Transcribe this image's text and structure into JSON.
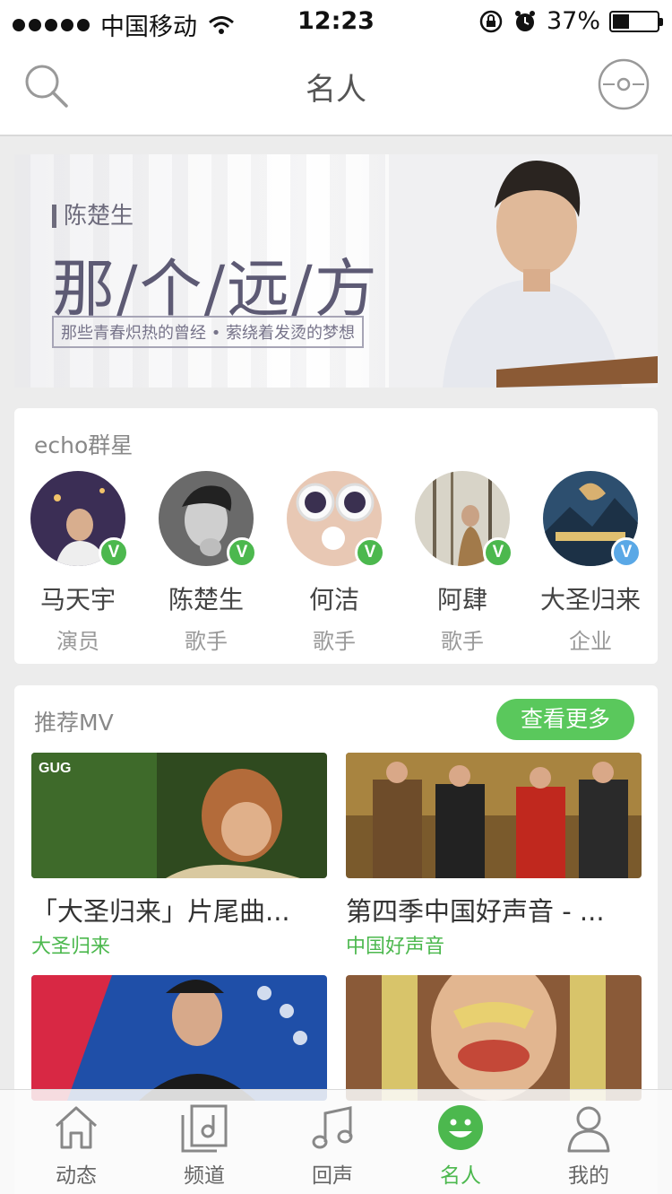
{
  "status_bar": {
    "carrier": "中国移动",
    "time": "12:23",
    "battery": "37%",
    "battery_level": 0.37
  },
  "nav": {
    "title": "名人",
    "search_icon": "search-icon",
    "player_icon": "disc-icon"
  },
  "banner": {
    "artist": "陈楚生",
    "title": "那/个/远/方",
    "subtitle": "那些青春炽热的曾经 • 萦绕着发烫的梦想"
  },
  "stars": {
    "heading": "echo群星",
    "items": [
      {
        "name": "马天宇",
        "role": "演员",
        "badge": "V",
        "badge_color": "#4cb84e"
      },
      {
        "name": "陈楚生",
        "role": "歌手",
        "badge": "V",
        "badge_color": "#4cb84e"
      },
      {
        "name": "何洁",
        "role": "歌手",
        "badge": "V",
        "badge_color": "#4cb84e"
      },
      {
        "name": "阿肆",
        "role": "歌手",
        "badge": "V",
        "badge_color": "#4cb84e"
      },
      {
        "name": "大圣归来",
        "role": "企业",
        "badge": "V",
        "badge_color": "#5aa8e6"
      }
    ]
  },
  "mv": {
    "heading": "推荐MV",
    "more_label": "查看更多",
    "items": [
      {
        "title": "「大圣归来」片尾曲...",
        "tag": "大圣归来"
      },
      {
        "title": "第四季中国好声音 - ...",
        "tag": "中国好声音"
      },
      {
        "title": "",
        "tag": ""
      },
      {
        "title": "",
        "tag": ""
      }
    ]
  },
  "tabs": [
    {
      "label": "动态",
      "icon": "home-icon"
    },
    {
      "label": "频道",
      "icon": "channel-icon"
    },
    {
      "label": "回声",
      "icon": "music-note-icon"
    },
    {
      "label": "名人",
      "icon": "smile-icon",
      "active": true
    },
    {
      "label": "我的",
      "icon": "person-icon"
    }
  ],
  "colors": {
    "accent": "#4cb84e",
    "button_green": "#5ac85c",
    "verified_blue": "#5aa8e6"
  }
}
